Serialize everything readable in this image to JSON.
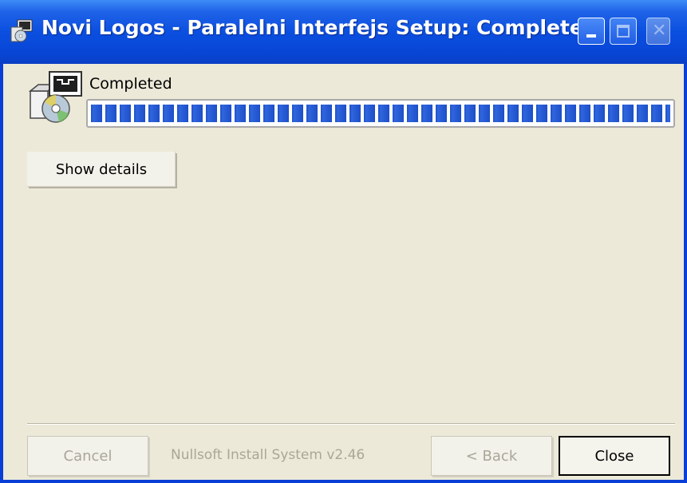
{
  "window": {
    "title": "Novi Logos - Paralelni Interfejs Setup: Completed"
  },
  "header": {
    "status": "Completed",
    "progress": 1.0
  },
  "buttons": {
    "show_details": "Show details",
    "cancel": "Cancel",
    "back": "< Back",
    "close": "Close"
  },
  "footer": {
    "branding": "Nullsoft Install System v2.46"
  },
  "colors": {
    "titlebar": "#0b4fe0",
    "progress": "#1f4fc7",
    "background": "#ece9d8"
  },
  "icons": {
    "app": "installer-icon",
    "setup": "setup-package-icon"
  }
}
